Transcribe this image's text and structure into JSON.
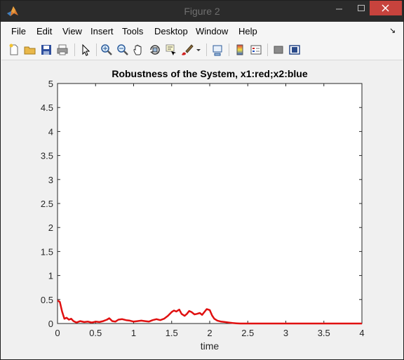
{
  "window": {
    "title": "Figure 2",
    "icon": "matlab-icon"
  },
  "menu": {
    "items": [
      "File",
      "Edit",
      "View",
      "Insert",
      "Tools",
      "Desktop",
      "Window",
      "Help"
    ],
    "overflow_icon": "dock-arrow-icon"
  },
  "toolbar": {
    "icons": [
      "new-figure-icon",
      "open-file-icon",
      "save-icon",
      "print-icon",
      "select-arrow-icon",
      "zoom-in-icon",
      "zoom-out-icon",
      "pan-hand-icon",
      "rotate-3d-icon",
      "data-cursor-icon",
      "brush-icon",
      "brush-dropdown-icon",
      "link-plot-icon",
      "colorbar-icon",
      "legend-icon",
      "hide-plot-tools-icon",
      "show-plot-tools-icon"
    ]
  },
  "chart_data": {
    "type": "line",
    "title": "Robustness of the System, x1:red;x2:blue",
    "xlabel": "time",
    "ylabel": "",
    "xlim": [
      0,
      4
    ],
    "ylim": [
      0,
      5
    ],
    "x_ticks": [
      "0",
      "0.5",
      "1",
      "1.5",
      "2",
      "2.5",
      "3",
      "3.5",
      "4"
    ],
    "y_ticks": [
      "0",
      "0.5",
      "1",
      "1.5",
      "2",
      "2.5",
      "3",
      "3.5",
      "4",
      "4.5",
      "5"
    ],
    "grid": false,
    "series": [
      {
        "color": "#e01010",
        "x": [
          0,
          0.03,
          0.06,
          0.09,
          0.12,
          0.15,
          0.18,
          0.21,
          0.25,
          0.3,
          0.35,
          0.4,
          0.45,
          0.5,
          0.55,
          0.6,
          0.65,
          0.68,
          0.72,
          0.76,
          0.8,
          0.85,
          0.9,
          0.95,
          1.0,
          1.05,
          1.1,
          1.15,
          1.2,
          1.25,
          1.3,
          1.35,
          1.4,
          1.45,
          1.5,
          1.53,
          1.56,
          1.6,
          1.63,
          1.67,
          1.7,
          1.73,
          1.76,
          1.8,
          1.83,
          1.87,
          1.9,
          1.93,
          1.96,
          2.0,
          2.03,
          2.06,
          2.1,
          2.15,
          2.2,
          2.25,
          2.3,
          2.35,
          2.4,
          2.5,
          3.0,
          3.5,
          4.0
        ],
        "y": [
          0.48,
          0.45,
          0.25,
          0.1,
          0.12,
          0.08,
          0.1,
          0.05,
          0.02,
          0.05,
          0.03,
          0.04,
          0.02,
          0.04,
          0.03,
          0.05,
          0.08,
          0.11,
          0.05,
          0.04,
          0.08,
          0.09,
          0.07,
          0.06,
          0.04,
          0.05,
          0.06,
          0.05,
          0.04,
          0.07,
          0.09,
          0.07,
          0.1,
          0.16,
          0.24,
          0.27,
          0.25,
          0.29,
          0.2,
          0.16,
          0.2,
          0.26,
          0.24,
          0.19,
          0.2,
          0.22,
          0.18,
          0.24,
          0.3,
          0.28,
          0.17,
          0.1,
          0.06,
          0.04,
          0.03,
          0.02,
          0.01,
          0.005,
          0.0,
          0.0,
          0.0,
          0.0,
          0.0
        ]
      }
    ]
  }
}
